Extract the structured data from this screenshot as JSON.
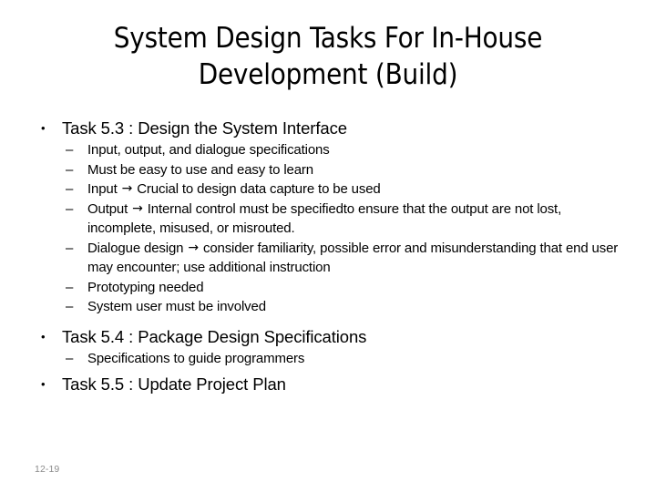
{
  "slide": {
    "title_lines": [
      "System Design Tasks For In-House",
      "Development (Build)"
    ],
    "footer": "12-19",
    "bullets": {
      "level1_marker": "•",
      "level2_marker": "–",
      "arrow_glyph": "→"
    },
    "colors": {
      "background": "#ffffff",
      "text": "#000000",
      "footer_text": "#8c8c8c"
    },
    "items": [
      {
        "label": "Task 5.3 : Design the System Interface",
        "subitems": [
          {
            "pre": "Input, output, and dialogue specifications",
            "arrow": false,
            "post": ""
          },
          {
            "pre": "Must be easy to use and easy to learn",
            "arrow": false,
            "post": ""
          },
          {
            "pre": "Input ",
            "arrow": true,
            "post": " Crucial to design data capture to be used"
          },
          {
            "pre": "Output ",
            "arrow": true,
            "post": " Internal control must be specifiedto ensure that the output are not lost, incomplete, misused, or misrouted."
          },
          {
            "pre": "Dialogue design ",
            "arrow": true,
            "post": " consider familiarity, possible error and misunderstanding that end user may encounter; use additional instruction"
          },
          {
            "pre": "Prototyping needed",
            "arrow": false,
            "post": ""
          },
          {
            "pre": "System user must be involved",
            "arrow": false,
            "post": ""
          }
        ]
      },
      {
        "label": "Task 5.4 : Package Design Specifications",
        "subitems": [
          {
            "pre": "Specifications to guide programmers",
            "arrow": false,
            "post": ""
          }
        ]
      },
      {
        "label": "Task 5.5 : Update Project Plan",
        "subitems": []
      }
    ]
  }
}
